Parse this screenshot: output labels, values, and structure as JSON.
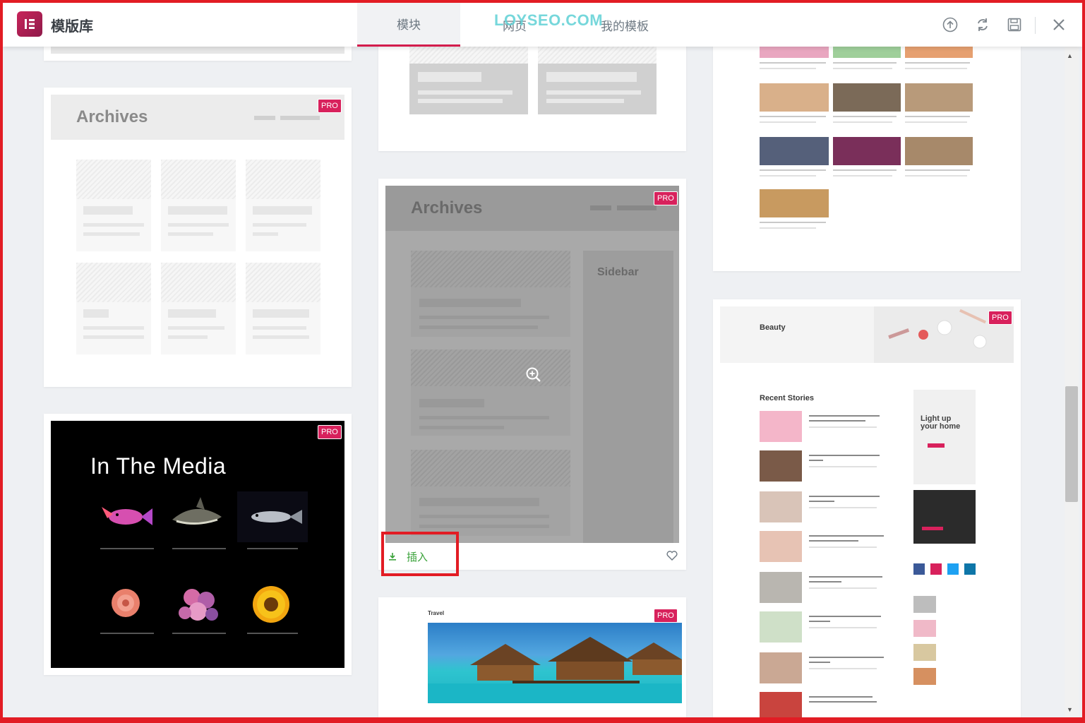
{
  "header": {
    "title": "模版库",
    "tabs": [
      {
        "label": "模块",
        "active": true
      },
      {
        "label": "网页",
        "active": false
      },
      {
        "label": "我的模板",
        "active": false
      }
    ],
    "watermark": "LOYSEO.COM",
    "icons": [
      "upload-icon",
      "sync-icon",
      "save-icon",
      "close-icon"
    ]
  },
  "cards": {
    "pro_badge": "PRO",
    "archives_left": {
      "title": "Archives"
    },
    "media": {
      "title": "In The Media",
      "items": [
        "pink-fish-photo",
        "shark-photo",
        "silver-fish-photo",
        "rose-photo",
        "flower-bouquet-photo",
        "sunflower-photo"
      ]
    },
    "archives_center": {
      "title": "Archives",
      "sidebar": "Sidebar",
      "insert_label": "插入"
    },
    "travel": {
      "label": "Travel"
    },
    "beauty": {
      "label": "Beauty",
      "recent": "Recent Stories"
    }
  },
  "colors": {
    "accent": "#d31c4c",
    "pro": "#d8215c",
    "insert": "#3aa23a",
    "highlight_box": "#e21c24"
  }
}
